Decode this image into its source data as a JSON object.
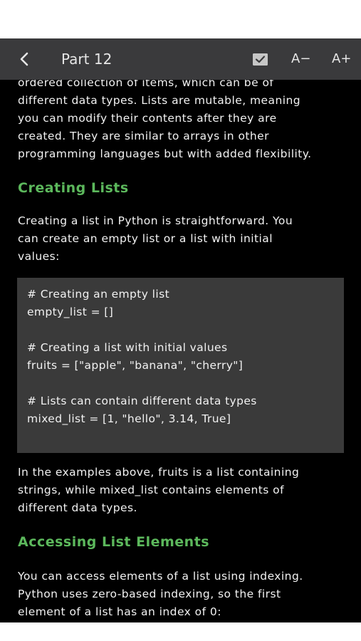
{
  "navbar": {
    "title": "Part 12",
    "back_icon": "chevron-left-icon",
    "bookmark_icon": "bookmark-check-icon",
    "font_decrease_label": "A−",
    "font_increase_label": "A+"
  },
  "article": {
    "intro_lines": [
      "ordered collection of items, which can be of",
      "different data types. Lists are mutable, meaning",
      "you can modify their contents after they are",
      "created. They are similar to arrays in other",
      "programming languages but with added flexibility."
    ],
    "heading_creating": "Creating Lists",
    "creating_lines": [
      "Creating a list in Python is straightforward. You",
      "can create an empty list or a list with initial",
      "values:"
    ],
    "code_lines": [
      "# Creating an empty list",
      "empty_list = []",
      "# Creating a list with initial values",
      "fruits = [\"apple\", \"banana\", \"cherry\"]",
      "# Lists can contain different data types",
      "mixed_list = [1, \"hello\", 3.14, True]"
    ],
    "examples_lines": [
      "In the examples above, fruits is a list containing",
      "strings, while mixed_list contains elements of",
      "different data types."
    ],
    "heading_accessing": "Accessing List Elements",
    "accessing_lines": [
      "You can access elements of a list using indexing.",
      "Python uses zero-based indexing, so the first",
      "element of a list has an index of 0:"
    ]
  },
  "colors": {
    "background": "#000000",
    "navbar": "#3a3a3c",
    "heading_accent": "#5cb85c",
    "code_background": "#3a3a3a",
    "text": "#f2f2f2"
  }
}
